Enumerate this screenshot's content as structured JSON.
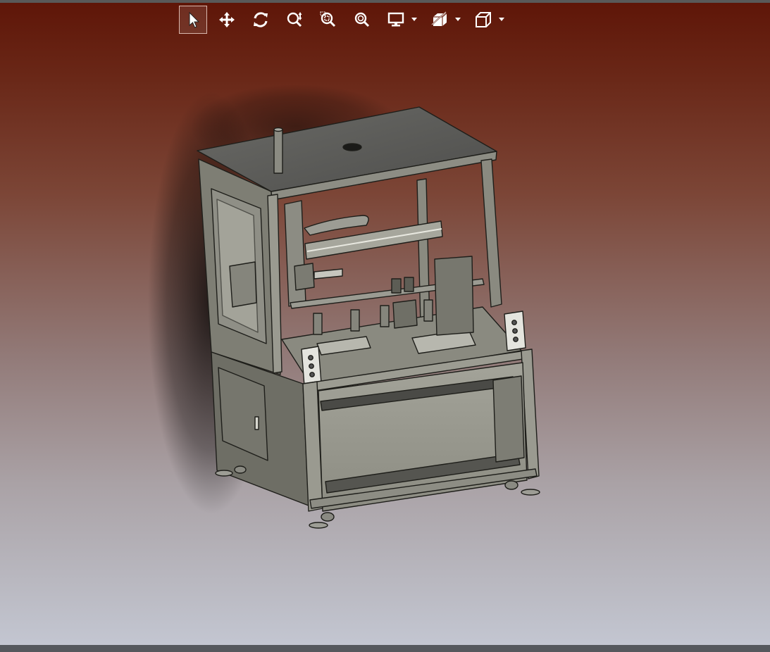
{
  "toolbar": {
    "buttons": [
      {
        "icon": "select-arrow-icon",
        "active": true
      },
      {
        "icon": "pan-move-icon",
        "active": false
      },
      {
        "icon": "rotate-icon",
        "active": false
      },
      {
        "icon": "zoom-icon",
        "active": false
      },
      {
        "icon": "zoom-window-icon",
        "active": false
      },
      {
        "icon": "zoom-fit-icon",
        "active": false
      },
      {
        "icon": "display-mode-icon",
        "dropdown": true
      },
      {
        "icon": "section-view-icon",
        "dropdown": true
      },
      {
        "icon": "view-orientation-cube-icon",
        "dropdown": true
      }
    ]
  },
  "viewport": {
    "background_top": "#5f1608",
    "background_bottom": "#c3c6d1",
    "model": "machine-enclosure-3d-model"
  },
  "colors": {
    "toolbar_icon": "#ffffff",
    "active_border": "#d9b8ae",
    "metal_light": "#9a9a8f",
    "metal_mid": "#7d7d72",
    "metal_dark": "#5e5e55",
    "edge": "#1e1e1a"
  }
}
